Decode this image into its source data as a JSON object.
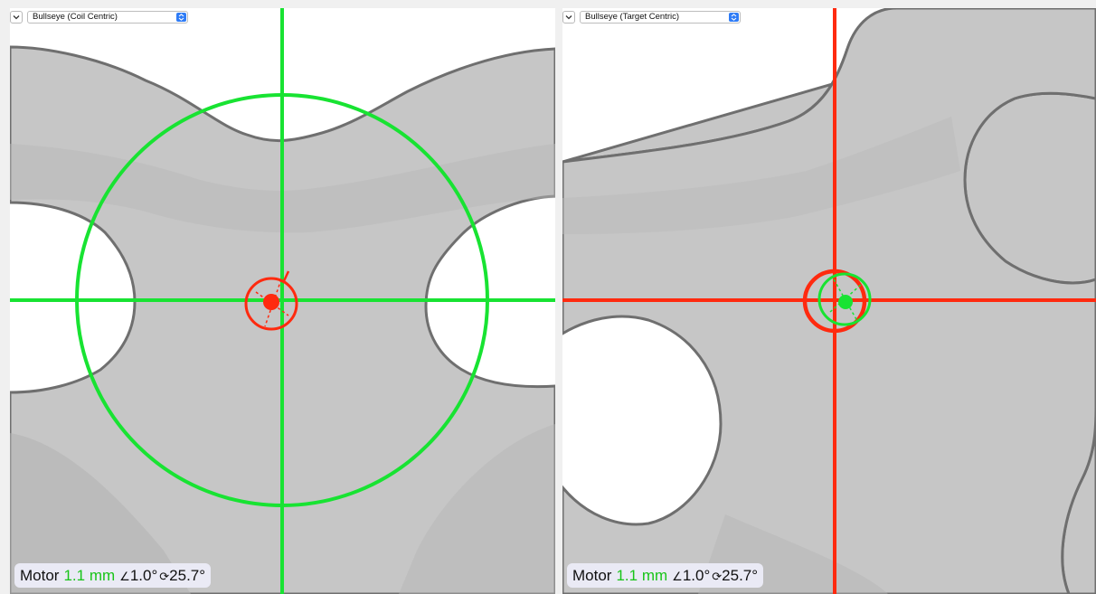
{
  "panels": [
    {
      "view_label": "Bullseye (Coil Centric)",
      "status": {
        "label": "Motor",
        "distance": "1.1 mm",
        "tilt_symbol": "∠",
        "tilt": "1.0°",
        "rotation_symbol": "⟳",
        "rotation": "25.7°"
      }
    },
    {
      "view_label": "Bullseye (Target Centric)",
      "status": {
        "label": "Motor",
        "distance": "1.1 mm",
        "tilt_symbol": "∠",
        "tilt": "1.0°",
        "rotation_symbol": "⟳",
        "rotation": "25.7°"
      }
    }
  ],
  "colors": {
    "coil_marker": "#ff2a0f",
    "target_marker": "#18e332",
    "tissue": "#c6c6c6",
    "select_arrows": "#2f7cf6"
  }
}
